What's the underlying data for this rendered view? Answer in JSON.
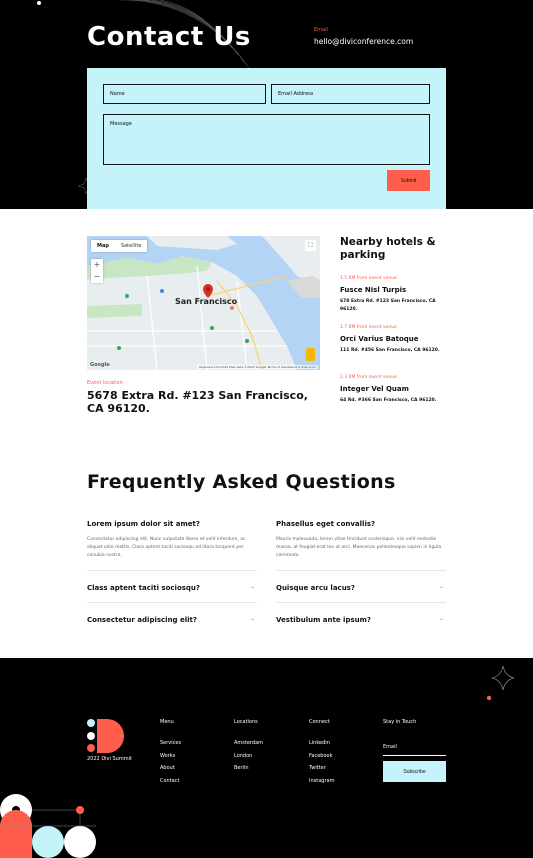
{
  "contact": {
    "title": "Contact Us",
    "email_label": "Email",
    "email_value": "hello@diviconference.com",
    "form": {
      "name_placeholder": "Name",
      "email_placeholder": "Email Address",
      "message_placeholder": "Message",
      "submit_label": "Submit"
    }
  },
  "map": {
    "tab_map": "Map",
    "tab_satellite": "Satellite",
    "city_label": "San Francisco",
    "google_label": "Google",
    "credits": "Keyboard shortcuts   Map data ©2022 Google   Terms of Use   Report a map error"
  },
  "event": {
    "label": "Event location",
    "address": "5678 Extra Rd. #123 San Francisco, CA 96120."
  },
  "nearby": {
    "title": "Nearby hotels & parking",
    "hotels": [
      {
        "distance": "1.5 KM from event venue",
        "name": "Fusce Nisl Turpis",
        "address": "678 Extra Rd. #123 San Francisco, CA 96120."
      },
      {
        "distance": "1.7 KM from event venue",
        "name": "Orci Varius Batoque",
        "address": "111 Rd. #456 San Francisco, CA 96120."
      },
      {
        "distance": "2.3 KM from event venue",
        "name": "Integer Vel Quam",
        "address": "64 Rd. #366 San Francisco, CA 96120."
      }
    ]
  },
  "faq": {
    "title": "Frequently Asked Questions",
    "left": {
      "open_question": "Lorem ipsum dolor sit amet?",
      "open_answer": "Consectetur adipiscing elit. Nunc vulputate libero et velit interdum, ac aliquet odio mattis. Class aptent taciti sociosqu ad litora torquent per conubia nostra.",
      "items": [
        "Class aptent taciti sociosqu?",
        "Consectetur adipiscing elit?"
      ]
    },
    "right": {
      "open_question": "Phasellus eget convallis?",
      "open_answer": "Mauris malesuada, lorem vitae tincidunt scelerisque, nisi velit molestie massa, at feugiat erat leo ut orci. Maecenas pellentesque sapien in ligula commodo.",
      "items": [
        "Quisque arcu lacus?",
        "Vestibulum ante ipsum?"
      ]
    },
    "chevron_icon": "chevron-down-icon"
  },
  "footer": {
    "copyright": "2022 Divi Summit",
    "menu": {
      "heading": "Menu",
      "links": [
        "Services",
        "Works",
        "About",
        "Contact"
      ]
    },
    "locations": {
      "heading": "Locations",
      "links": [
        "Amsterdam",
        "London",
        "Berlin"
      ]
    },
    "connect": {
      "heading": "Connect",
      "links": [
        "Linkedin",
        "Facebook",
        "Twitter",
        "Instagram"
      ]
    },
    "stay": {
      "heading": "Stay in Touch",
      "email_placeholder": "Email",
      "subscribe_label": "Subscribe"
    }
  },
  "colors": {
    "accent": "#ff5e4d",
    "panel": "#c4f3fa",
    "dark": "#000000"
  }
}
